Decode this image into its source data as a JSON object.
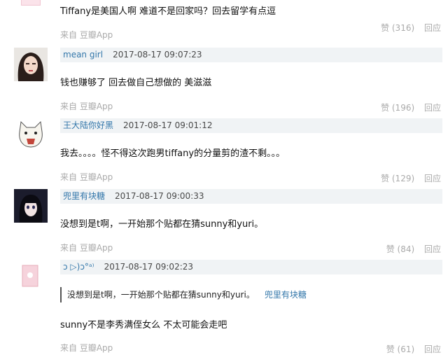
{
  "comments": [
    {
      "content": "Tiffany是美国人啊 难道不是回家吗？回去留学有点逗",
      "source": "来自 豆瓣App",
      "likes": "赞 (316)",
      "reply": "回应"
    },
    {
      "user": "mean girl",
      "time": "2017-08-17 09:07:23",
      "content": "钱也赚够了 回去做自己想做的 美滋滋",
      "source": "来自 豆瓣App",
      "likes": "赞 (196)",
      "reply": "回应"
    },
    {
      "user": "王大陆你好黑",
      "time": "2017-08-17 09:01:12",
      "content": "我去。。。。怪不得这次跑男tiffany的分量剪的渣不剩。。。",
      "source": "来自 豆瓣App",
      "likes": "赞 (129)",
      "reply": "回应"
    },
    {
      "user": "兜里有块糖",
      "time": "2017-08-17 09:00:33",
      "content": "没想到是t啊，一开始那个贴都在猜sunny和yuri。",
      "source": "来自 豆瓣App",
      "likes": "赞 (84)",
      "reply": "回应"
    },
    {
      "user": "ↄ ▷)ↄ°ᵃ⁾",
      "time": "2017-08-17 09:02:23",
      "quote_text": "没想到是t啊，一开始那个贴都在猜sunny和yuri。",
      "quote_user": "兜里有块糖",
      "content": "sunny不是李秀满侄女么 不太可能会走吧",
      "source": "来自 豆瓣App",
      "likes": "赞 (61)",
      "reply": "回应"
    }
  ]
}
